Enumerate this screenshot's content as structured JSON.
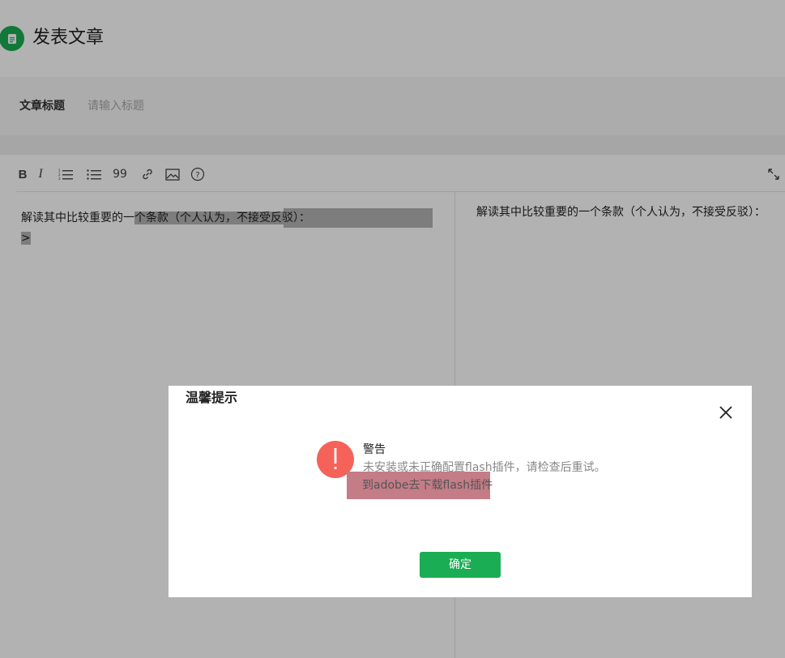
{
  "page": {
    "title": "发表文章",
    "icon": "document-icon",
    "accent_color": "#1aad53"
  },
  "title_field": {
    "label": "文章标题",
    "placeholder": "请输入标题",
    "value": ""
  },
  "toolbar": {
    "items": [
      {
        "name": "bold",
        "glyph": "B"
      },
      {
        "name": "italic",
        "glyph": "I"
      },
      {
        "name": "ordered-list",
        "icon": "ordered-list-icon"
      },
      {
        "name": "unordered-list",
        "icon": "unordered-list-icon"
      },
      {
        "name": "quote",
        "glyph": "99"
      },
      {
        "name": "link",
        "icon": "link-icon"
      },
      {
        "name": "image",
        "icon": "image-icon"
      },
      {
        "name": "help",
        "icon": "help-icon"
      },
      {
        "name": "fullscreen",
        "icon": "fullscreen-icon"
      }
    ]
  },
  "editor": {
    "source_line_1_plain": "解读其中比较重要的一",
    "source_line_1_selected": "个条款（个人认为，不接受反驳）：",
    "source_line_2": ">",
    "preview_text": "解读其中比较重要的一个条款（个人认为，不接受反驳）："
  },
  "modal": {
    "title": "温馨提示",
    "close_icon": "close-icon",
    "warning_icon": "exclamation-icon",
    "warning_color": "#f5625a",
    "heading": "警告",
    "message": "未安装或未正确配置flash插件，请检查后重试。",
    "link_text": "到adobe去下载flash插件",
    "confirm_label": "确定"
  }
}
